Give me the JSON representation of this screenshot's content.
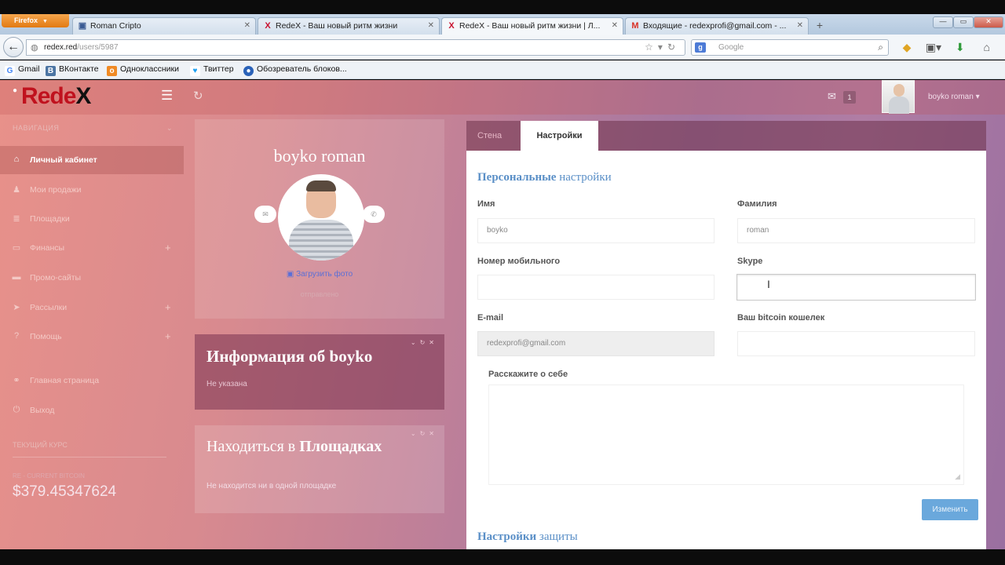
{
  "browser": {
    "app_button": "Firefox",
    "tabs": [
      {
        "title": "Roman Cripto"
      },
      {
        "title": "RedeX - Ваш новый ритм жизни"
      },
      {
        "title": "RedeX - Ваш новый ритм жизни | Л..."
      },
      {
        "title": "Входящие - redexprofi@gmail.com - ..."
      }
    ],
    "url_host": "redex.red",
    "url_path": "/users/5987",
    "search_placeholder": "Google",
    "bookmarks": [
      "Gmail",
      "ВКонтакте",
      "Одноклассники",
      "Твиттер",
      "Обозреватель блоков..."
    ]
  },
  "site": {
    "logo_main": "Rede",
    "logo_x": "X",
    "mail_count": "1",
    "username": "boyko roman"
  },
  "sidebar": {
    "section_title": "НАВИГАЦИЯ",
    "items": [
      {
        "label": "Личный кабинет",
        "icon": "home-icon"
      },
      {
        "label": "Мои продажи",
        "icon": "user-icon"
      },
      {
        "label": "Площадки",
        "icon": "list-icon"
      },
      {
        "label": "Финансы",
        "icon": "card-icon"
      },
      {
        "label": "Промо-сайты",
        "icon": "monitor-icon"
      },
      {
        "label": "Рассылки",
        "icon": "send-icon"
      },
      {
        "label": "Помощь",
        "icon": "help-icon"
      },
      {
        "label": "Главная страница",
        "icon": "link-icon"
      },
      {
        "label": "Выход",
        "icon": "power-icon"
      }
    ],
    "course_title": "ТЕКУЩИЙ КУРС",
    "course_sub": "RE - CURRENT BITCOIN",
    "course_value": "$379.45347624"
  },
  "profile": {
    "name": "boyko roman",
    "upload_label": "Загрузить фото",
    "upload_sub": "отправлено"
  },
  "info_card": {
    "title": "Информация об boyko",
    "text": "Не указана"
  },
  "locations_card": {
    "title_regular": "Находиться в ",
    "title_bold": "Площадках",
    "text": "Не находится ни в одной площадке"
  },
  "panel": {
    "tab_wall": "Стена",
    "tab_settings": "Настройки",
    "section_title_bold": "Персональные",
    "section_title_rest": " настройки",
    "fields": {
      "first_name_label": "Имя",
      "first_name_value": "boyko",
      "last_name_label": "Фамилия",
      "last_name_value": "roman",
      "mobile_label": "Номер мобильного",
      "mobile_value": "",
      "skype_label": "Skype",
      "skype_value": "",
      "email_label": "E-mail",
      "email_value": "redexprofi@gmail.com",
      "bitcoin_label": "Ваш bitcoin кошелек",
      "bitcoin_value": "",
      "about_label": "Расскажите о себе"
    },
    "save_button": "Изменить",
    "section2_title_bold": "Настройки",
    "section2_title_rest": " защиты"
  }
}
